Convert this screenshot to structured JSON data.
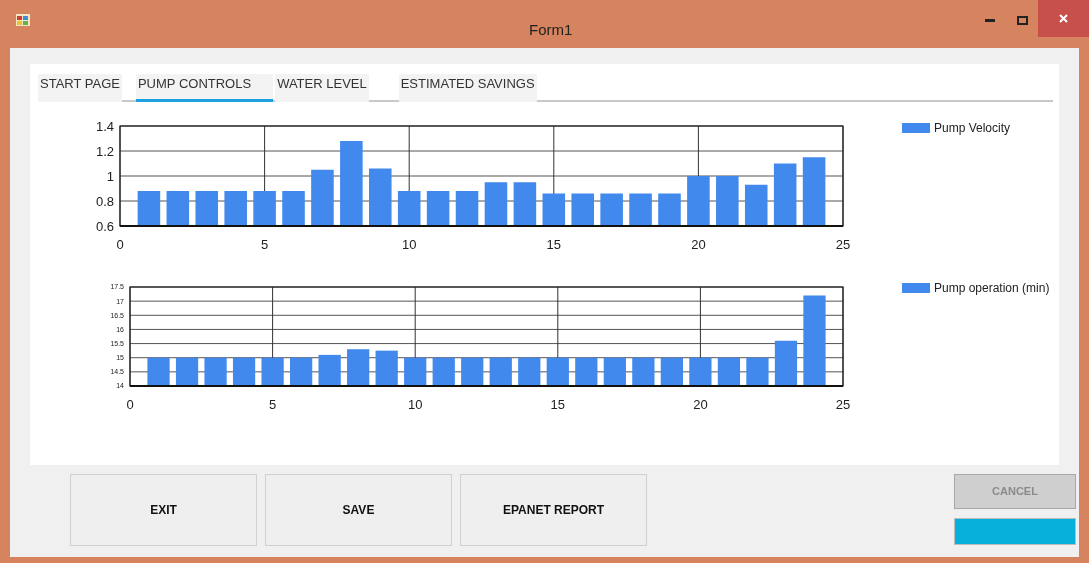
{
  "window": {
    "title": "Form1"
  },
  "tabs": [
    {
      "label": "START PAGE",
      "selected": false
    },
    {
      "label": "PUMP CONTROLS",
      "selected": true
    },
    {
      "label": "WATER LEVEL",
      "selected": false
    },
    {
      "label": "ESTIMATED SAVINGS",
      "selected": false
    }
  ],
  "charts": [
    {
      "chart_data": {
        "type": "bar",
        "x": [
          1,
          2,
          3,
          4,
          5,
          6,
          7,
          8,
          9,
          10,
          11,
          12,
          13,
          14,
          15,
          16,
          17,
          18,
          19,
          20,
          21,
          22,
          23,
          24
        ],
        "series": [
          {
            "name": "Pump Velocity",
            "color": "#4189ec",
            "values": [
              0.88,
              0.88,
              0.88,
              0.88,
              0.88,
              0.88,
              1.05,
              1.28,
              1.06,
              0.88,
              0.88,
              0.88,
              0.95,
              0.95,
              0.86,
              0.86,
              0.86,
              0.86,
              0.86,
              1.0,
              1.0,
              0.93,
              1.1,
              1.15
            ]
          }
        ],
        "xlim": [
          0,
          25
        ],
        "ylim": [
          0.6,
          1.4
        ],
        "grid": true,
        "xticks": [
          0,
          5,
          10,
          15,
          20,
          25
        ],
        "yticks": [
          0.6,
          0.8,
          {
            "value": 1,
            "label": "1"
          },
          1.2,
          1.4
        ]
      }
    },
    {
      "chart_data": {
        "type": "bar",
        "x": [
          1,
          2,
          3,
          4,
          5,
          6,
          7,
          8,
          9,
          10,
          11,
          12,
          13,
          14,
          15,
          16,
          17,
          18,
          19,
          20,
          21,
          22,
          23,
          24
        ],
        "series": [
          {
            "name": "Pump operation (min)",
            "color": "#4189ec",
            "values": [
              15,
              15,
              15,
              15,
              15,
              15,
              15.1,
              15.3,
              15.25,
              15,
              15,
              15,
              15,
              15,
              15,
              15,
              15,
              15,
              15,
              15,
              15,
              15,
              15.6,
              17.2
            ]
          }
        ],
        "xlim": [
          0,
          25
        ],
        "ylim": [
          14,
          17.5
        ],
        "grid": true,
        "xticks": [
          0,
          5,
          10,
          15,
          20,
          25
        ],
        "yticks": [
          14,
          14.5,
          15,
          15.5,
          16,
          16.5,
          17,
          17.5
        ]
      }
    }
  ],
  "buttons": [
    {
      "label": "EXIT"
    },
    {
      "label": "SAVE"
    },
    {
      "label": "EPANET REPORT"
    }
  ],
  "cancel_button": {
    "label": "CANCEL",
    "disabled": true
  },
  "progress_bar": {
    "level": 1
  }
}
